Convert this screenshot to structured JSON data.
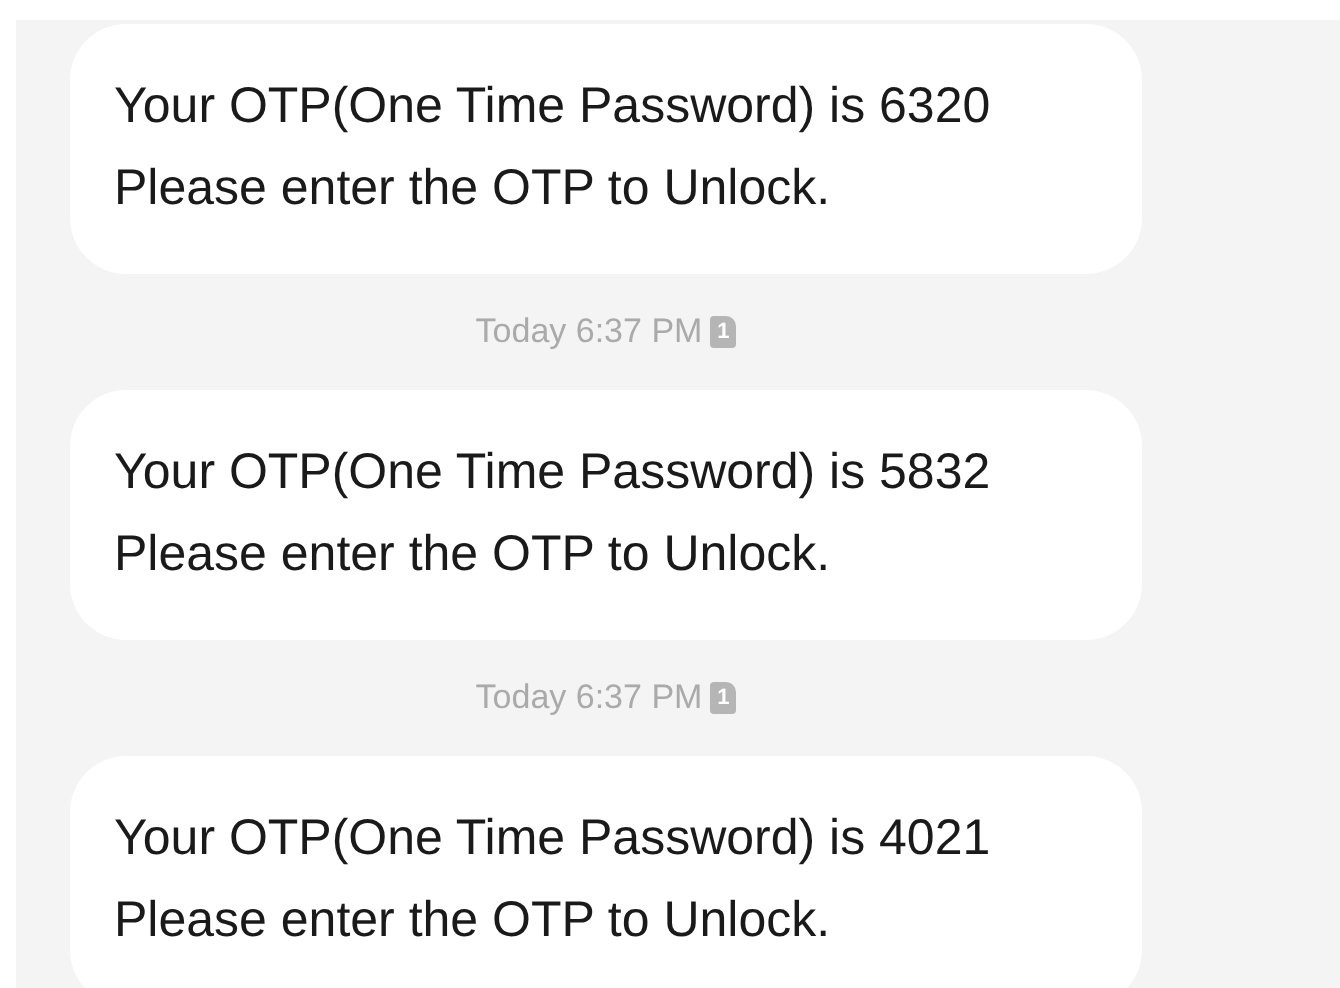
{
  "messages": [
    {
      "text": "Your OTP(One Time Password) is 6320 Please enter the OTP to Unlock.",
      "time": "Today 6:37 PM",
      "sim": "1"
    },
    {
      "text": "Your OTP(One Time Password) is 5832 Please enter the OTP to Unlock.",
      "time": "Today 6:37 PM",
      "sim": "1"
    },
    {
      "text": "Your OTP(One Time Password) is 4021 Please enter the OTP to Unlock."
    }
  ]
}
